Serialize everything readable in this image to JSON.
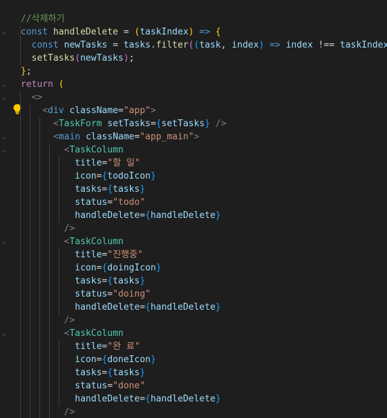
{
  "colors": {
    "background": "#1e1e1e",
    "comment": "#6a9955",
    "keyword": "#569cd6",
    "control": "#c586c0",
    "function": "#dcdcaa",
    "variable": "#9cdcfe",
    "text": "#d4d4d4",
    "tag": "#4ec9b0",
    "html_tag": "#569cd6",
    "tag_bracket": "#808080",
    "string": "#ce9178",
    "brace_yellow": "#ffd700",
    "brace_purple": "#da70d6",
    "brace_blue": "#179fff"
  },
  "editor": {
    "icons": [
      "lightbulb-icon",
      "fold-chevron-icon"
    ],
    "lines": [
      {
        "tokens": [
          {
            "t": "//삭제하기",
            "c": "comment"
          }
        ]
      },
      {
        "tokens": [
          {
            "t": "const ",
            "c": "keyword"
          },
          {
            "t": "handleDelete",
            "c": "function"
          },
          {
            "t": " = ",
            "c": "text"
          },
          {
            "t": "(",
            "c": "brace_yellow"
          },
          {
            "t": "taskIndex",
            "c": "variable"
          },
          {
            "t": ")",
            "c": "brace_yellow"
          },
          {
            "t": " => ",
            "c": "keyword"
          },
          {
            "t": "{",
            "c": "brace_yellow"
          }
        ]
      },
      {
        "tokens": [
          {
            "t": "  ",
            "c": "text"
          },
          {
            "t": "const ",
            "c": "keyword"
          },
          {
            "t": "newTasks",
            "c": "variable"
          },
          {
            "t": " = ",
            "c": "text"
          },
          {
            "t": "tasks",
            "c": "variable"
          },
          {
            "t": ".",
            "c": "text"
          },
          {
            "t": "filter",
            "c": "function"
          },
          {
            "t": "(",
            "c": "brace_purple"
          },
          {
            "t": "(",
            "c": "brace_blue"
          },
          {
            "t": "task",
            "c": "variable"
          },
          {
            "t": ", ",
            "c": "text"
          },
          {
            "t": "index",
            "c": "variable"
          },
          {
            "t": ")",
            "c": "brace_blue"
          },
          {
            "t": " => ",
            "c": "keyword"
          },
          {
            "t": "index",
            "c": "variable"
          },
          {
            "t": " !== ",
            "c": "text"
          },
          {
            "t": "taskIndex",
            "c": "variable"
          },
          {
            "t": ")",
            "c": "brace_purple"
          },
          {
            "t": ";",
            "c": "text"
          }
        ]
      },
      {
        "tokens": [
          {
            "t": "  ",
            "c": "text"
          },
          {
            "t": "setTasks",
            "c": "function"
          },
          {
            "t": "(",
            "c": "brace_purple"
          },
          {
            "t": "newTasks",
            "c": "variable"
          },
          {
            "t": ")",
            "c": "brace_purple"
          },
          {
            "t": ";",
            "c": "text"
          }
        ]
      },
      {
        "tokens": [
          {
            "t": "}",
            "c": "brace_yellow"
          },
          {
            "t": ";",
            "c": "text"
          }
        ]
      },
      {
        "tokens": [
          {
            "t": "return ",
            "c": "control"
          },
          {
            "t": "(",
            "c": "brace_yellow"
          }
        ]
      },
      {
        "tokens": [
          {
            "t": "  ",
            "c": "text"
          },
          {
            "t": "<>",
            "c": "tag_bracket"
          }
        ]
      },
      {
        "tokens": [
          {
            "t": "    ",
            "c": "text"
          },
          {
            "t": "<",
            "c": "tag_bracket"
          },
          {
            "t": "div",
            "c": "html_tag"
          },
          {
            "t": " ",
            "c": "text"
          },
          {
            "t": "className",
            "c": "variable"
          },
          {
            "t": "=",
            "c": "text"
          },
          {
            "t": "\"app\"",
            "c": "string"
          },
          {
            "t": ">",
            "c": "tag_bracket"
          }
        ]
      },
      {
        "tokens": [
          {
            "t": "      ",
            "c": "text"
          },
          {
            "t": "<",
            "c": "tag_bracket"
          },
          {
            "t": "TaskForm",
            "c": "tag"
          },
          {
            "t": " ",
            "c": "text"
          },
          {
            "t": "setTasks",
            "c": "variable"
          },
          {
            "t": "=",
            "c": "text"
          },
          {
            "t": "{",
            "c": "brace_blue"
          },
          {
            "t": "setTasks",
            "c": "variable"
          },
          {
            "t": "}",
            "c": "brace_blue"
          },
          {
            "t": " />",
            "c": "tag_bracket"
          }
        ]
      },
      {
        "tokens": [
          {
            "t": "      ",
            "c": "text"
          },
          {
            "t": "<",
            "c": "tag_bracket"
          },
          {
            "t": "main",
            "c": "html_tag"
          },
          {
            "t": " ",
            "c": "text"
          },
          {
            "t": "className",
            "c": "variable"
          },
          {
            "t": "=",
            "c": "text"
          },
          {
            "t": "\"app_main\"",
            "c": "string"
          },
          {
            "t": ">",
            "c": "tag_bracket"
          }
        ]
      },
      {
        "tokens": [
          {
            "t": "        ",
            "c": "text"
          },
          {
            "t": "<",
            "c": "tag_bracket"
          },
          {
            "t": "TaskColumn",
            "c": "tag"
          }
        ]
      },
      {
        "tokens": [
          {
            "t": "          ",
            "c": "text"
          },
          {
            "t": "title",
            "c": "variable"
          },
          {
            "t": "=",
            "c": "text"
          },
          {
            "t": "\"할 일\"",
            "c": "string"
          }
        ]
      },
      {
        "tokens": [
          {
            "t": "          ",
            "c": "text"
          },
          {
            "t": "icon",
            "c": "variable"
          },
          {
            "t": "=",
            "c": "text"
          },
          {
            "t": "{",
            "c": "brace_blue"
          },
          {
            "t": "todoIcon",
            "c": "variable"
          },
          {
            "t": "}",
            "c": "brace_blue"
          }
        ]
      },
      {
        "tokens": [
          {
            "t": "          ",
            "c": "text"
          },
          {
            "t": "tasks",
            "c": "variable"
          },
          {
            "t": "=",
            "c": "text"
          },
          {
            "t": "{",
            "c": "brace_blue"
          },
          {
            "t": "tasks",
            "c": "variable"
          },
          {
            "t": "}",
            "c": "brace_blue"
          }
        ]
      },
      {
        "tokens": [
          {
            "t": "          ",
            "c": "text"
          },
          {
            "t": "status",
            "c": "variable"
          },
          {
            "t": "=",
            "c": "text"
          },
          {
            "t": "\"todo\"",
            "c": "string"
          }
        ]
      },
      {
        "tokens": [
          {
            "t": "          ",
            "c": "text"
          },
          {
            "t": "handleDelete",
            "c": "variable"
          },
          {
            "t": "=",
            "c": "text"
          },
          {
            "t": "{",
            "c": "brace_blue"
          },
          {
            "t": "handleDelete",
            "c": "variable"
          },
          {
            "t": "}",
            "c": "brace_blue"
          }
        ]
      },
      {
        "tokens": [
          {
            "t": "        ",
            "c": "text"
          },
          {
            "t": "/>",
            "c": "tag_bracket"
          }
        ]
      },
      {
        "tokens": [
          {
            "t": "        ",
            "c": "text"
          },
          {
            "t": "<",
            "c": "tag_bracket"
          },
          {
            "t": "TaskColumn",
            "c": "tag"
          }
        ]
      },
      {
        "tokens": [
          {
            "t": "          ",
            "c": "text"
          },
          {
            "t": "title",
            "c": "variable"
          },
          {
            "t": "=",
            "c": "text"
          },
          {
            "t": "\"진행중\"",
            "c": "string"
          }
        ]
      },
      {
        "tokens": [
          {
            "t": "          ",
            "c": "text"
          },
          {
            "t": "icon",
            "c": "variable"
          },
          {
            "t": "=",
            "c": "text"
          },
          {
            "t": "{",
            "c": "brace_blue"
          },
          {
            "t": "doingIcon",
            "c": "variable"
          },
          {
            "t": "}",
            "c": "brace_blue"
          }
        ]
      },
      {
        "tokens": [
          {
            "t": "          ",
            "c": "text"
          },
          {
            "t": "tasks",
            "c": "variable"
          },
          {
            "t": "=",
            "c": "text"
          },
          {
            "t": "{",
            "c": "brace_blue"
          },
          {
            "t": "tasks",
            "c": "variable"
          },
          {
            "t": "}",
            "c": "brace_blue"
          }
        ]
      },
      {
        "tokens": [
          {
            "t": "          ",
            "c": "text"
          },
          {
            "t": "status",
            "c": "variable"
          },
          {
            "t": "=",
            "c": "text"
          },
          {
            "t": "\"doing\"",
            "c": "string"
          }
        ]
      },
      {
        "tokens": [
          {
            "t": "          ",
            "c": "text"
          },
          {
            "t": "handleDelete",
            "c": "variable"
          },
          {
            "t": "=",
            "c": "text"
          },
          {
            "t": "{",
            "c": "brace_blue"
          },
          {
            "t": "handleDelete",
            "c": "variable"
          },
          {
            "t": "}",
            "c": "brace_blue"
          }
        ]
      },
      {
        "tokens": [
          {
            "t": "        ",
            "c": "text"
          },
          {
            "t": "/>",
            "c": "tag_bracket"
          }
        ]
      },
      {
        "tokens": [
          {
            "t": "        ",
            "c": "text"
          },
          {
            "t": "<",
            "c": "tag_bracket"
          },
          {
            "t": "TaskColumn",
            "c": "tag"
          }
        ]
      },
      {
        "tokens": [
          {
            "t": "          ",
            "c": "text"
          },
          {
            "t": "title",
            "c": "variable"
          },
          {
            "t": "=",
            "c": "text"
          },
          {
            "t": "\"완 료\"",
            "c": "string"
          }
        ]
      },
      {
        "tokens": [
          {
            "t": "          ",
            "c": "text"
          },
          {
            "t": "icon",
            "c": "variable"
          },
          {
            "t": "=",
            "c": "text"
          },
          {
            "t": "{",
            "c": "brace_blue"
          },
          {
            "t": "doneIcon",
            "c": "variable"
          },
          {
            "t": "}",
            "c": "brace_blue"
          }
        ]
      },
      {
        "tokens": [
          {
            "t": "          ",
            "c": "text"
          },
          {
            "t": "tasks",
            "c": "variable"
          },
          {
            "t": "=",
            "c": "text"
          },
          {
            "t": "{",
            "c": "brace_blue"
          },
          {
            "t": "tasks",
            "c": "variable"
          },
          {
            "t": "}",
            "c": "brace_blue"
          }
        ]
      },
      {
        "tokens": [
          {
            "t": "          ",
            "c": "text"
          },
          {
            "t": "status",
            "c": "variable"
          },
          {
            "t": "=",
            "c": "text"
          },
          {
            "t": "\"done\"",
            "c": "string"
          }
        ]
      },
      {
        "tokens": [
          {
            "t": "          ",
            "c": "text"
          },
          {
            "t": "handleDelete",
            "c": "variable"
          },
          {
            "t": "=",
            "c": "text"
          },
          {
            "t": "{",
            "c": "brace_blue"
          },
          {
            "t": "handleDelete",
            "c": "variable"
          },
          {
            "t": "}",
            "c": "brace_blue"
          }
        ]
      },
      {
        "tokens": [
          {
            "t": "        ",
            "c": "text"
          },
          {
            "t": "/>",
            "c": "tag_bracket"
          }
        ]
      }
    ]
  }
}
